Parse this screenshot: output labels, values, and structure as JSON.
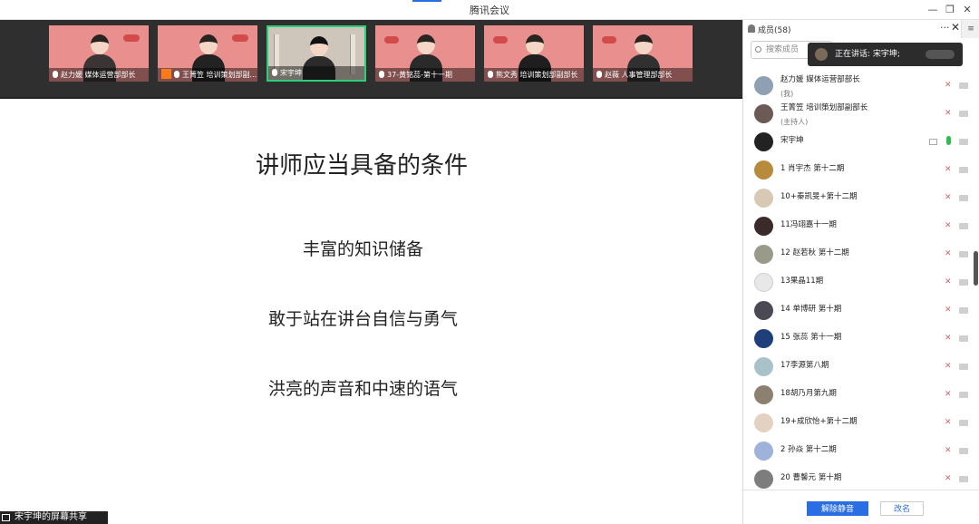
{
  "window": {
    "title": "腾讯会议"
  },
  "video_tiles": [
    {
      "label": "赵力媛 媒体运营部部长"
    },
    {
      "label": "王箐笠 培训策划部副..."
    },
    {
      "label": "宋宇坤"
    },
    {
      "label": "37-黄铭蕊-第十一期"
    },
    {
      "label": "熊文秀 培训策划部副部长"
    },
    {
      "label": "赵薇 人事管理部部长"
    }
  ],
  "slide": {
    "title": "讲师应当具备的条件",
    "lines": [
      "丰富的知识储备",
      "敢于站在讲台自信与勇气",
      "洪亮的声音和中速的语气"
    ]
  },
  "share_bar": {
    "label": "宋宇坤的屏幕共享"
  },
  "panel": {
    "header": "成员(58)",
    "search_placeholder": "搜索成员",
    "speaking": "正在讲话: 宋宇坤;",
    "members": [
      {
        "name": "赵力媛 媒体运营部部长",
        "role": "(我)",
        "mic": "off",
        "avatar_color": "#8ea0b2"
      },
      {
        "name": "王箐笠 培训策划部副部长",
        "role": "(主持人)",
        "mic": "off",
        "avatar_color": "#6b5a55"
      },
      {
        "name": "宋宇坤",
        "role": "",
        "mic": "on",
        "avatar_color": "#222222"
      },
      {
        "name": "1 肖宇杰 第十二期",
        "role": "",
        "mic": "off",
        "avatar_color": "#b88a3c"
      },
      {
        "name": "10+秦凯旻+第十二期",
        "role": "",
        "mic": "off",
        "avatar_color": "#d8c9b5"
      },
      {
        "name": "11冯翊嘉十一期",
        "role": "",
        "mic": "off",
        "avatar_color": "#3a2a2a"
      },
      {
        "name": "12 赵若秋 第十二期",
        "role": "",
        "mic": "off",
        "avatar_color": "#9a9a8a"
      },
      {
        "name": "13果晶11期",
        "role": "",
        "mic": "off",
        "avatar_color": "#e8e8e8"
      },
      {
        "name": "14 单博研 第十期",
        "role": "",
        "mic": "off",
        "avatar_color": "#4a4a55"
      },
      {
        "name": "15 张蕊 第十一期",
        "role": "",
        "mic": "off",
        "avatar_color": "#1f3f7a"
      },
      {
        "name": "17李源第八期",
        "role": "",
        "mic": "off",
        "avatar_color": "#a9c2c9"
      },
      {
        "name": "18胡乃月第九期",
        "role": "",
        "mic": "off",
        "avatar_color": "#8c8170"
      },
      {
        "name": "19+成欣怡+第十二期",
        "role": "",
        "mic": "off",
        "avatar_color": "#e3d2c2"
      },
      {
        "name": "2 孙焱 第十二期",
        "role": "",
        "mic": "off",
        "avatar_color": "#9fb2d9"
      },
      {
        "name": "20 曹馨元 第十期",
        "role": "",
        "mic": "off",
        "avatar_color": "#7d7d7d"
      }
    ],
    "buttons": {
      "unmute": "解除静音",
      "rename": "改名"
    }
  }
}
